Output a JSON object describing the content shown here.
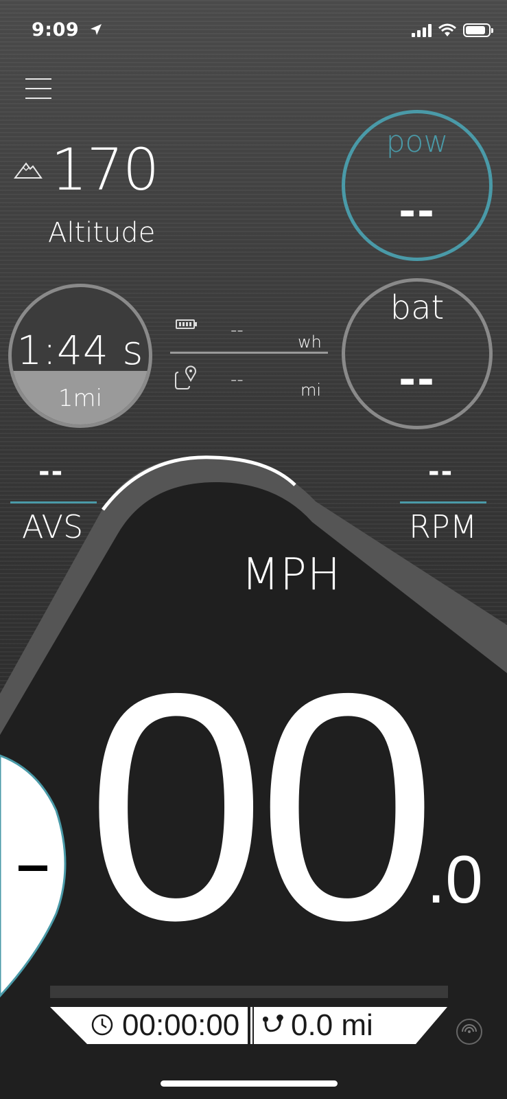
{
  "status_bar": {
    "time": "9:09"
  },
  "altitude": {
    "value": "170",
    "label": "Altitude"
  },
  "power": {
    "label": "pow",
    "value": "--"
  },
  "battery_gauge": {
    "label": "bat",
    "value": "--"
  },
  "lap": {
    "time": "1:44 s",
    "distance": "1mi"
  },
  "energy": {
    "value": "--",
    "unit": "wh"
  },
  "range": {
    "value": "--",
    "unit": "mi"
  },
  "avs": {
    "value": "--",
    "label": "AVS"
  },
  "rpm": {
    "value": "--",
    "label": "RPM"
  },
  "speed": {
    "unit": "MPH",
    "integer": "00",
    "decimal": ".0"
  },
  "left_bubble": {
    "value": "-"
  },
  "trip": {
    "elapsed": "00:00:00",
    "distance": "0.0 mi"
  },
  "colors": {
    "accent": "#4a9aa8",
    "ring_gray": "#8a8a8a",
    "dash_black": "#1f1f1f"
  },
  "icons": [
    "location-arrow-icon",
    "signal-icon",
    "wifi-icon",
    "battery-icon",
    "menu-icon",
    "mountain-icon",
    "battery-small-icon",
    "route-pin-icon",
    "clock-icon",
    "route-icon",
    "record-icon"
  ]
}
